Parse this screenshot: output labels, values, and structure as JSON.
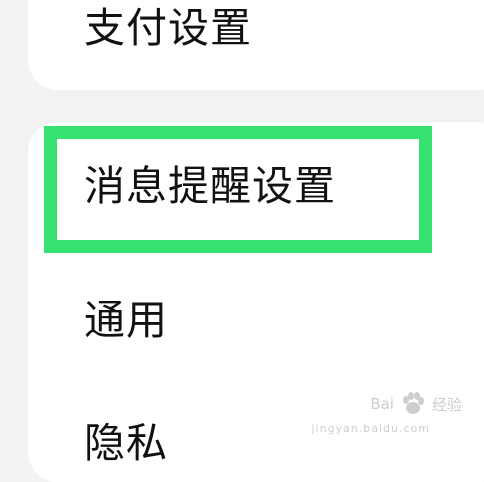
{
  "settings": {
    "items": [
      {
        "label": "支付设置"
      },
      {
        "label": "消息提醒设置"
      },
      {
        "label": "通用"
      },
      {
        "label": "隐私"
      }
    ]
  },
  "highlight": {
    "color": "#35e16f"
  },
  "watermark": {
    "brand": "Bai",
    "suffix": "经验",
    "domain": "jingyan.baidu.com",
    "icon": "baidu-paw-icon"
  }
}
